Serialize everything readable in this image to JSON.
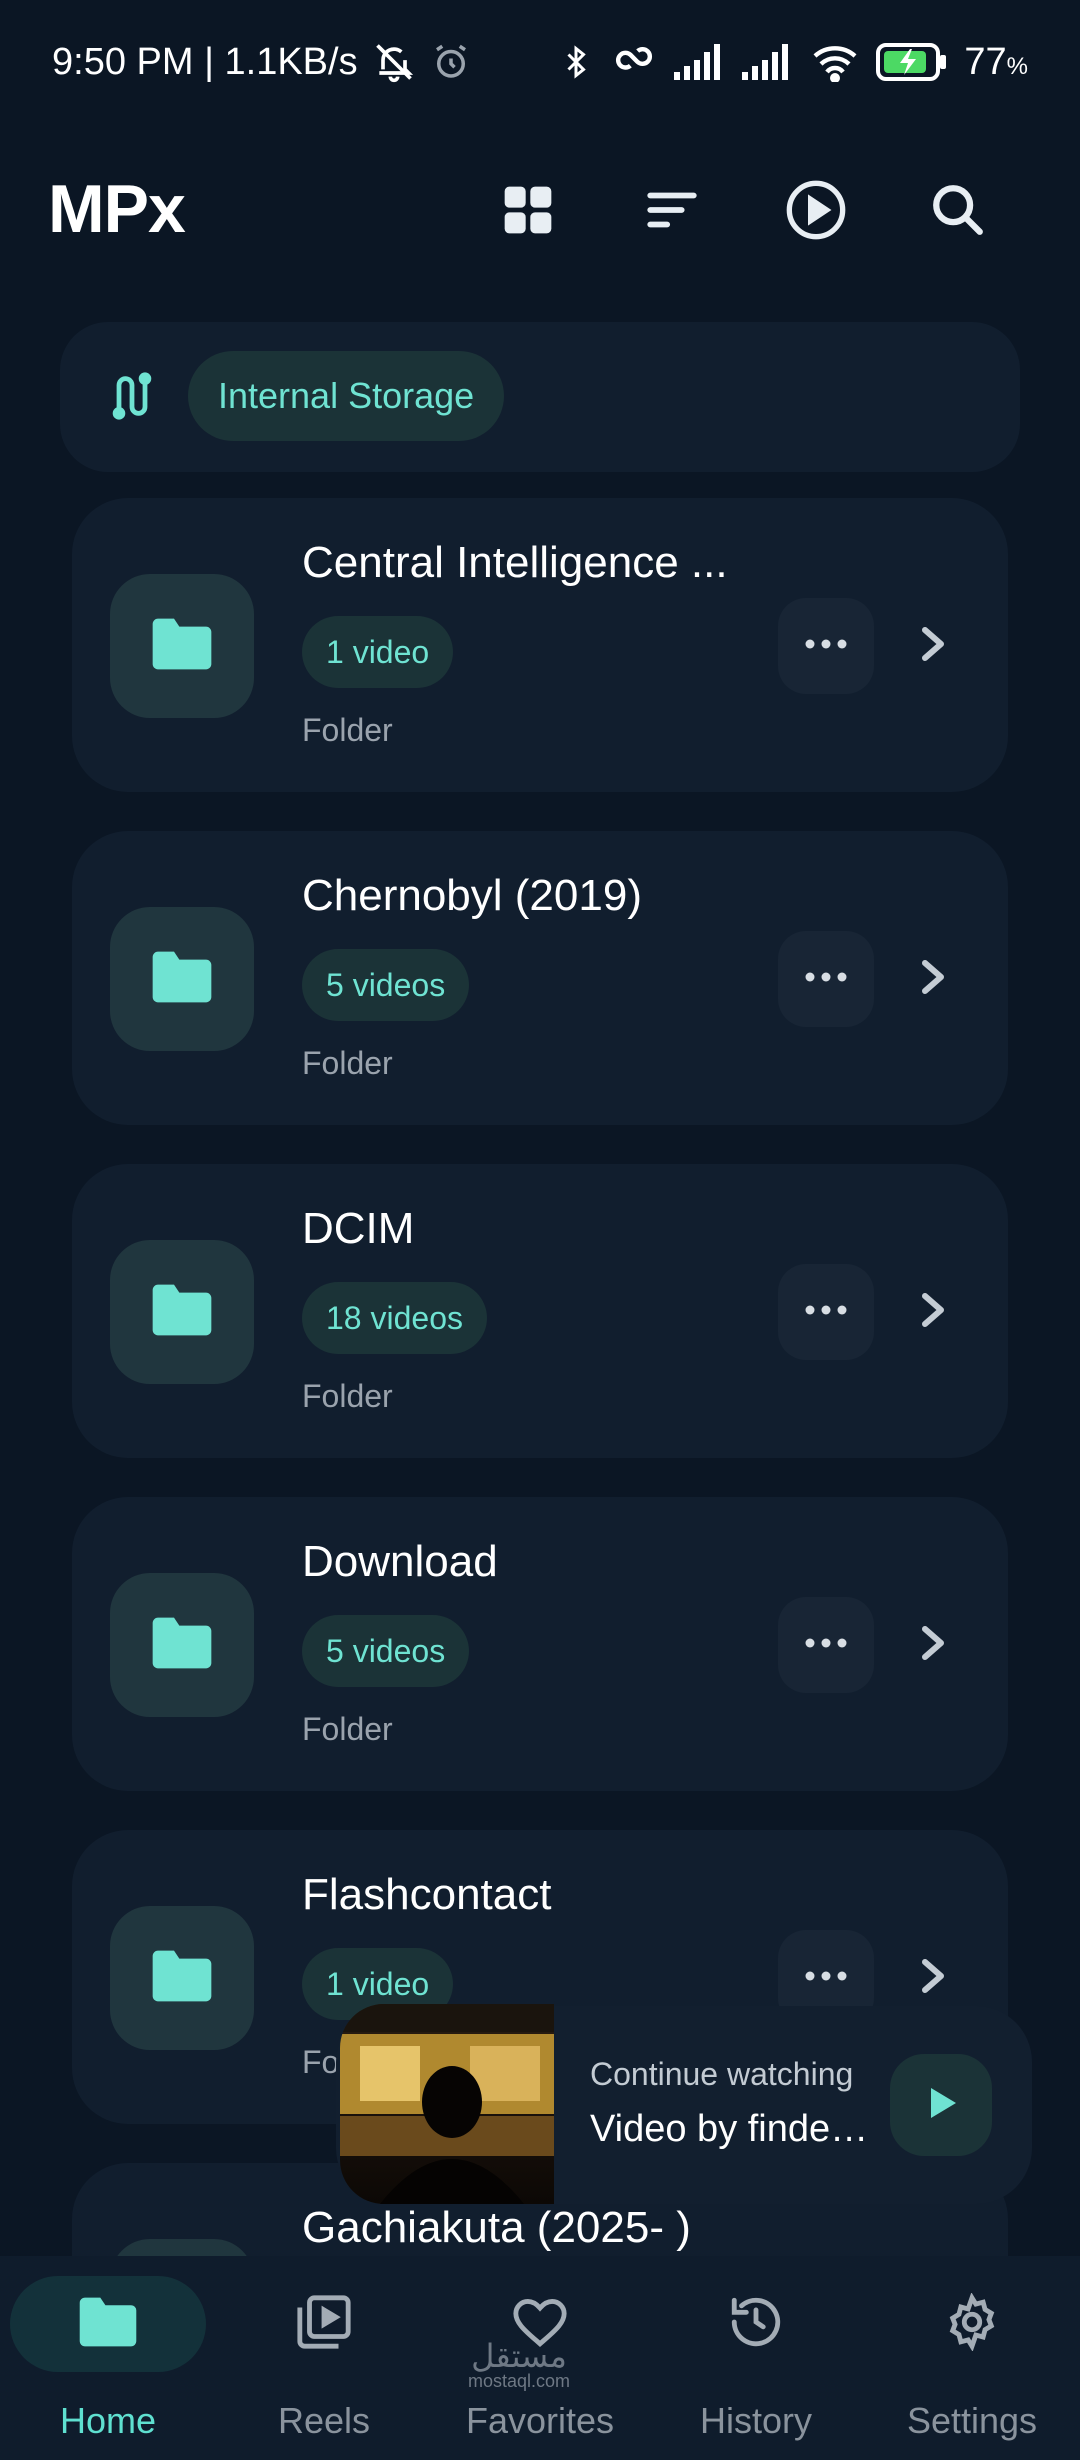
{
  "status_bar": {
    "time": "9:50 PM | 1.1KB/s",
    "battery": "77",
    "battery_unit": "%"
  },
  "header": {
    "title": "MPx",
    "icons": [
      "grid-view-icon",
      "sort-icon",
      "play-circle-icon",
      "search-icon"
    ]
  },
  "storage": {
    "label": "Internal Storage",
    "icon": "storage-path-icon"
  },
  "folders": [
    {
      "name": "Central Intelligence ...",
      "count": "1 video",
      "type": "Folder"
    },
    {
      "name": "Chernobyl (2019)",
      "count": "5 videos",
      "type": "Folder"
    },
    {
      "name": "DCIM",
      "count": "18 videos",
      "type": "Folder"
    },
    {
      "name": "Download",
      "count": "5 videos",
      "type": "Folder"
    },
    {
      "name": "Flashcontact",
      "count": "1 video",
      "type": "Fo"
    },
    {
      "name": "Gachiakuta (2025- )"
    }
  ],
  "continue_watching": {
    "label": "Continue watching",
    "title": "Video by findex..."
  },
  "nav": {
    "items": [
      {
        "label": "Home",
        "icon": "folder-icon",
        "active": true
      },
      {
        "label": "Reels",
        "icon": "reels-icon",
        "active": false
      },
      {
        "label": "Favorites",
        "icon": "heart-icon",
        "active": false
      },
      {
        "label": "History",
        "icon": "history-icon",
        "active": false
      },
      {
        "label": "Settings",
        "icon": "gear-icon",
        "active": false
      }
    ]
  },
  "watermark": {
    "text": "مستقل",
    "sub": "mostaql.com"
  },
  "colors": {
    "accent": "#6fe3d2",
    "background": "#0b1624",
    "card": "#111e2e",
    "chip": "#1b3337"
  }
}
